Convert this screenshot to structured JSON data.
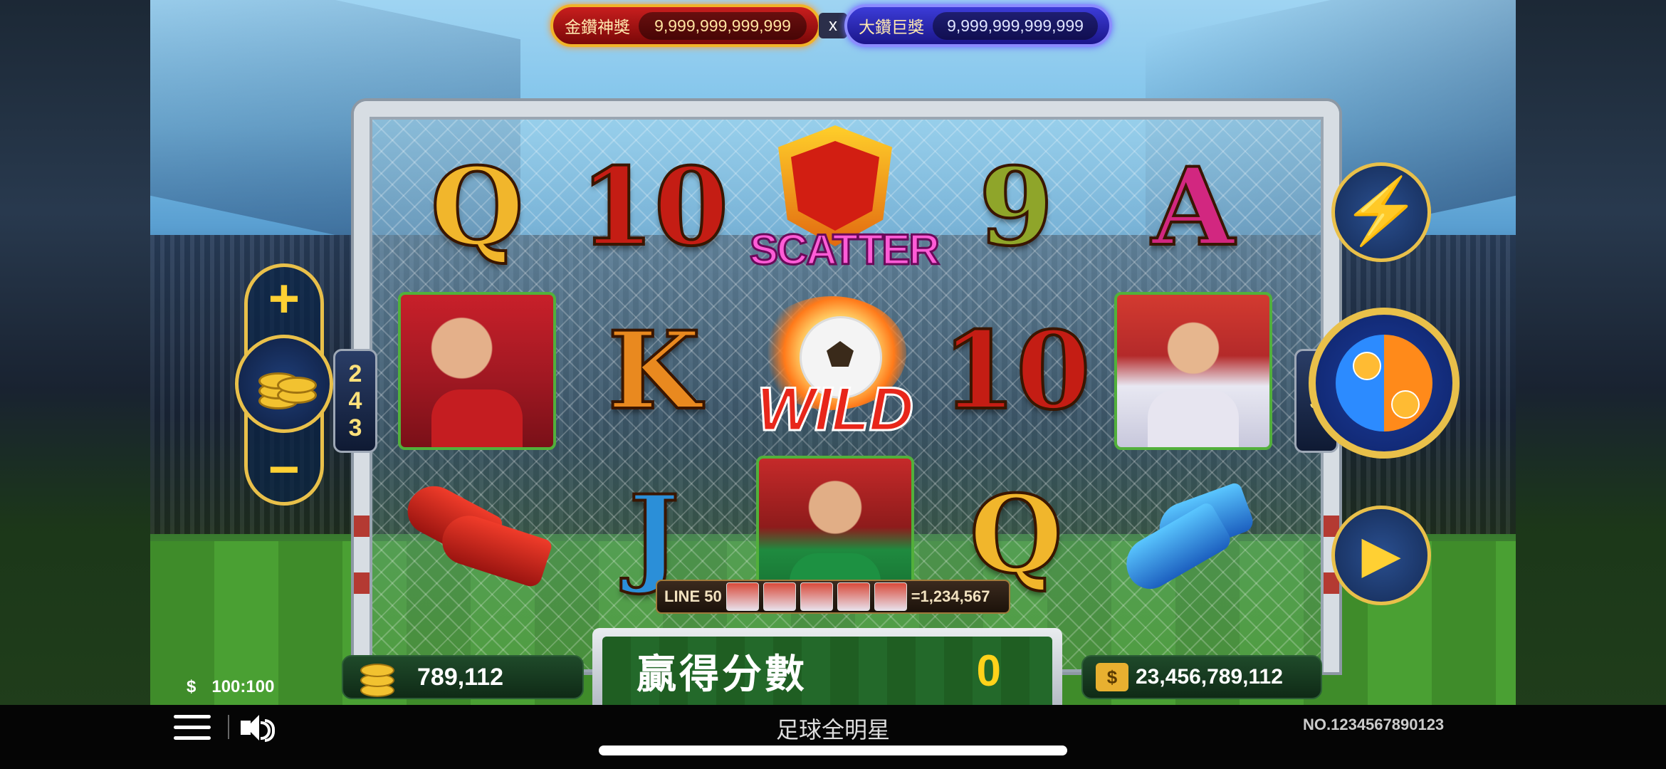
{
  "jackpots": {
    "gold": {
      "label": "金鑽神獎",
      "value": "9,999,999,999,999"
    },
    "separator": "x",
    "blue": {
      "label": "大鑽巨獎",
      "value": "9,999,999,999,999"
    }
  },
  "reels": {
    "row1": [
      "Q",
      "10",
      "SCATTER",
      "9",
      "A"
    ],
    "row2": [
      "player-portrait",
      "K",
      "WILD",
      "10",
      "player-portrait"
    ],
    "row3": [
      "red-boots",
      "J",
      "goalkeeper-portrait",
      "Q",
      "blue-gloves"
    ]
  },
  "scatter_label": "SCATTER",
  "wild_label": "WILD",
  "ways": {
    "left": [
      "2",
      "4",
      "3"
    ],
    "right": [
      "3"
    ]
  },
  "line_banner": {
    "label": "LINE 50",
    "payout": "=1,234,567"
  },
  "controls": {
    "bet_plus": "+",
    "bet_minus": "−",
    "turbo_icon": "lightning-icon",
    "spin_icon": "spin-icon",
    "autoplay_icon": "play-icon"
  },
  "rate": {
    "symbol": "$",
    "value": "100:100"
  },
  "bet": {
    "value": "789,112"
  },
  "win": {
    "label": "贏得分數",
    "value": "0"
  },
  "balance": {
    "value": "23,456,789,112"
  },
  "footer": {
    "title": "足球全明星",
    "game_no": "NO.1234567890123"
  },
  "colors": {
    "gold": "#e9c04a",
    "jackpot_red": "#c81e1e",
    "jackpot_blue": "#3c3cd8",
    "win_yellow": "#ffd21a"
  }
}
